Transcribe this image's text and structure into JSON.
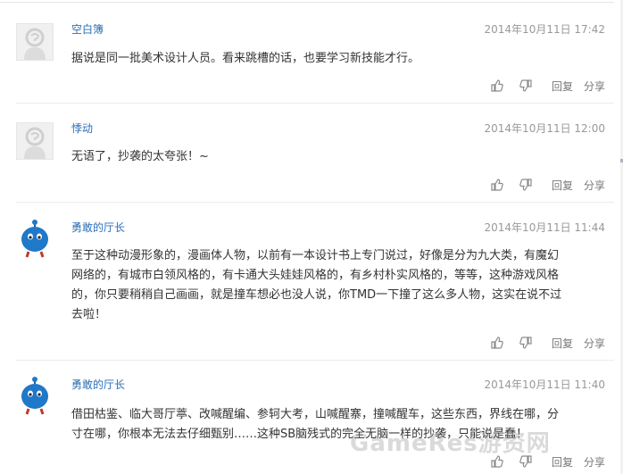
{
  "comments": [
    {
      "username": "空白簿",
      "timestamp": "2014年10月11日 17:42",
      "avatar": "default-avatar-icon",
      "lines": [
        "据说是同一批美术设计人员。看来跳槽的话，也要学习新技能才行。"
      ],
      "reply_label": "回复",
      "share_label": "分享"
    },
    {
      "username": "悸动",
      "timestamp": "2014年10月11日 12:00",
      "avatar": "default-avatar-icon",
      "lines": [
        "无语了，抄袭的太夸张！~"
      ],
      "reply_label": "回复",
      "share_label": "分享"
    },
    {
      "username": "勇敢的厅长",
      "timestamp": "2014年10月11日 11:44",
      "avatar": "blue-mascot-avatar-icon",
      "lines": [
        "至于这种动漫形象的，漫画体人物，以前有一本设计书上专门说过，好像是分为九大类，有魔幻",
        "网络的，有城市白领风格的，有卡通大头娃娃风格的，有乡村朴实风格的，等等，这种游戏风格",
        "的，你只要稍稍自己画画，就是撞车想必也没人说，你TMD一下撞了这么多人物，这实在说不过",
        "去啦！"
      ],
      "reply_label": "回复",
      "share_label": "分享"
    },
    {
      "username": "勇敢的厅长",
      "timestamp": "2014年10月11日 11:40",
      "avatar": "blue-mascot-avatar-icon",
      "lines": [
        "借田枯鉴、临大哥厅葶、改喊醒编、参轲大考，山喊醒寨，撞喊醒车，这些东西，界线在哪，分",
        "寸在哪，你根本无法去仔细甄别……这种SB脑残式的完全无脑一样的抄袭，只能说是蠢！"
      ],
      "reply_label": "回复",
      "share_label": "分享"
    }
  ],
  "watermark": "GameRes游资网",
  "colors": {
    "username": "#2b6fb6",
    "timestamp": "#999999",
    "body_text": "#333333",
    "action_text": "#777777",
    "divider": "#ececec"
  }
}
